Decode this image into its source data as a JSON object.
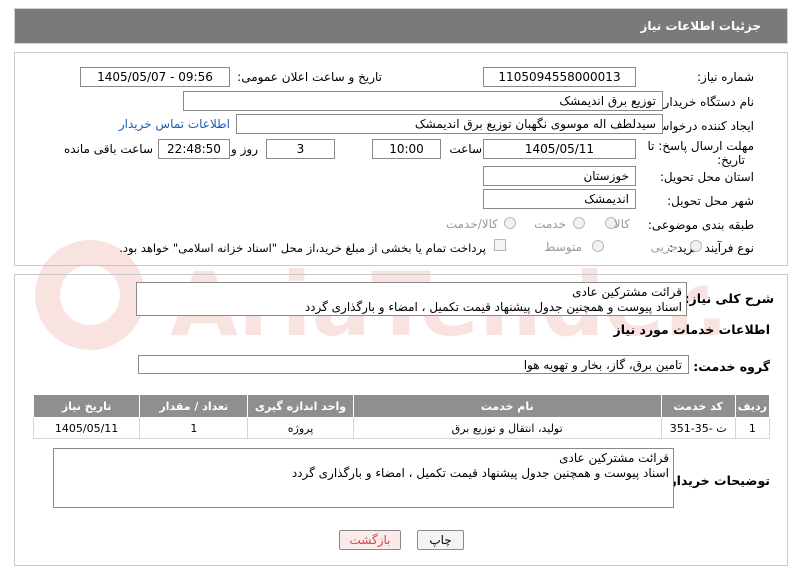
{
  "header": {
    "title": "جزئیات اطلاعات نیاز"
  },
  "watermark": {
    "text": "AriaTender.neT",
    "color": "#d9301f"
  },
  "fields": {
    "need_number_label": "شماره نیاز:",
    "need_number": "1105094558000013",
    "announce_label": "تاریخ و ساعت اعلان عمومی:",
    "announce_value": "1405/05/07 - 09:56",
    "buyer_org_label": "نام دستگاه خریدار:",
    "buyer_org": "توزیع برق اندیمشک",
    "creator_label": "ایجاد کننده درخواست:",
    "creator": "سیدلطف اله موسوی نگهبان توزیع برق اندیمشک",
    "contact_link": "اطلاعات تماس خریدار",
    "deadline_label_1": "مهلت ارسال پاسخ: تا",
    "deadline_label_2": "تاریخ:",
    "deadline_date": "1405/05/11",
    "time_label": "ساعت",
    "deadline_time": "10:00",
    "days_value": "3",
    "days_label": "روز و",
    "remaining_time": "22:48:50",
    "remaining_label": "ساعت باقی مانده",
    "province_label": "استان محل تحویل:",
    "province": "خوزستان",
    "city_label": "شهر محل تحویل:",
    "city": "اندیمشک",
    "category_label": "طبقه بندی موضوعی:",
    "category_options": [
      "کالا",
      "خدمت",
      "کالا/خدمت"
    ],
    "purchase_type_label": "نوع فرآیند خرید :",
    "purchase_type_options": [
      "جزیی",
      "متوسط"
    ],
    "payment_note": "پرداخت تمام یا بخشی از مبلغ خرید،از محل \"اسناد خزانه اسلامی\" خواهد بود."
  },
  "description": {
    "label": "شرح کلی نیاز:",
    "lines": [
      "قرائت مشترکین عادی",
      "اسناد پیوست و همچنین جدول پیشنهاد قیمت تکمیل ، امضاء  و بارگذاری گردد"
    ]
  },
  "services": {
    "section_title": "اطلاعات خدمات مورد نیاز",
    "group_label": "گروه خدمت:",
    "group_value": "تامین برق، گاز، بخار و تهویه هوا",
    "columns": [
      "ردیف",
      "کد خدمت",
      "نام خدمت",
      "واحد اندازه گیری",
      "تعداد / مقدار",
      "تاریخ نیاز"
    ],
    "rows": [
      [
        "1",
        "ت -35-351",
        "تولید، انتقال و توزیع برق",
        "پروژه",
        "1",
        "1405/05/11"
      ]
    ]
  },
  "buyer_notes": {
    "label": "توضیحات خریدار:",
    "lines": [
      "قرائت مشترکین عادی",
      "اسناد پیوست و همچنین جدول پیشنهاد قیمت تکمیل ، امضاء  و بارگذاری گردد"
    ]
  },
  "buttons": {
    "print": "چاپ",
    "back": "بازگشت"
  }
}
